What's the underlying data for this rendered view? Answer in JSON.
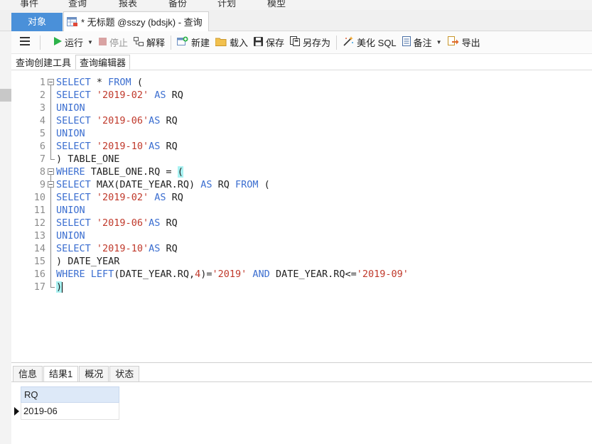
{
  "menu": {
    "items": [
      "事件",
      "查询",
      "报表",
      "备份",
      "计划",
      "模型"
    ]
  },
  "tabs": {
    "objects": "对象",
    "query": "* 无标题 @sszy (bdsjk) - 查询"
  },
  "toolbar": {
    "run": "运行",
    "stop": "停止",
    "explain": "解释",
    "new": "新建",
    "load": "载入",
    "save": "保存",
    "save_as": "另存为",
    "beautify": "美化 SQL",
    "notes": "备注",
    "export": "导出"
  },
  "subtabs": {
    "builder": "查询创建工具",
    "editor": "查询编辑器"
  },
  "editor": {
    "lines": [
      {
        "n": "1",
        "fold": "start",
        "tokens": [
          {
            "t": "kw",
            "v": "SELECT"
          },
          {
            "t": "pl",
            "v": " * "
          },
          {
            "t": "kw",
            "v": "FROM"
          },
          {
            "t": "pl",
            "v": " ("
          }
        ]
      },
      {
        "n": "2",
        "fold": "mid",
        "tokens": [
          {
            "t": "kw",
            "v": "SELECT"
          },
          {
            "t": "pl",
            "v": " "
          },
          {
            "t": "str",
            "v": "'2019-02'"
          },
          {
            "t": "pl",
            "v": " "
          },
          {
            "t": "kw",
            "v": "AS"
          },
          {
            "t": "pl",
            "v": " RQ"
          }
        ]
      },
      {
        "n": "3",
        "fold": "mid",
        "tokens": [
          {
            "t": "kw",
            "v": "UNION"
          }
        ]
      },
      {
        "n": "4",
        "fold": "mid",
        "tokens": [
          {
            "t": "kw",
            "v": "SELECT"
          },
          {
            "t": "pl",
            "v": " "
          },
          {
            "t": "str",
            "v": "'2019-06'"
          },
          {
            "t": "kw",
            "v": "AS"
          },
          {
            "t": "pl",
            "v": " RQ"
          }
        ]
      },
      {
        "n": "5",
        "fold": "mid",
        "tokens": [
          {
            "t": "kw",
            "v": "UNION"
          }
        ]
      },
      {
        "n": "6",
        "fold": "mid",
        "tokens": [
          {
            "t": "kw",
            "v": "SELECT"
          },
          {
            "t": "pl",
            "v": " "
          },
          {
            "t": "str",
            "v": "'2019-10'"
          },
          {
            "t": "kw",
            "v": "AS"
          },
          {
            "t": "pl",
            "v": " RQ"
          }
        ]
      },
      {
        "n": "7",
        "fold": "end",
        "tokens": [
          {
            "t": "pl",
            "v": ") TABLE_ONE"
          }
        ]
      },
      {
        "n": "8",
        "fold": "start",
        "tokens": [
          {
            "t": "kw",
            "v": "WHERE"
          },
          {
            "t": "pl",
            "v": " TABLE_ONE.RQ = "
          },
          {
            "t": "brm",
            "v": "("
          }
        ]
      },
      {
        "n": "9",
        "fold": "start2",
        "tokens": [
          {
            "t": "kw",
            "v": "SELECT"
          },
          {
            "t": "pl",
            "v": " MAX(DATE_YEAR.RQ) "
          },
          {
            "t": "kw",
            "v": "AS"
          },
          {
            "t": "pl",
            "v": " RQ "
          },
          {
            "t": "kw",
            "v": "FROM"
          },
          {
            "t": "pl",
            "v": " ("
          }
        ]
      },
      {
        "n": "10",
        "fold": "mid",
        "tokens": [
          {
            "t": "kw",
            "v": "SELECT"
          },
          {
            "t": "pl",
            "v": " "
          },
          {
            "t": "str",
            "v": "'2019-02'"
          },
          {
            "t": "pl",
            "v": " "
          },
          {
            "t": "kw",
            "v": "AS"
          },
          {
            "t": "pl",
            "v": " RQ"
          }
        ]
      },
      {
        "n": "11",
        "fold": "mid",
        "tokens": [
          {
            "t": "kw",
            "v": "UNION"
          }
        ]
      },
      {
        "n": "12",
        "fold": "mid",
        "tokens": [
          {
            "t": "kw",
            "v": "SELECT"
          },
          {
            "t": "pl",
            "v": " "
          },
          {
            "t": "str",
            "v": "'2019-06'"
          },
          {
            "t": "kw",
            "v": "AS"
          },
          {
            "t": "pl",
            "v": " RQ"
          }
        ]
      },
      {
        "n": "13",
        "fold": "mid",
        "tokens": [
          {
            "t": "kw",
            "v": "UNION"
          }
        ]
      },
      {
        "n": "14",
        "fold": "mid",
        "tokens": [
          {
            "t": "kw",
            "v": "SELECT"
          },
          {
            "t": "pl",
            "v": " "
          },
          {
            "t": "str",
            "v": "'2019-10'"
          },
          {
            "t": "kw",
            "v": "AS"
          },
          {
            "t": "pl",
            "v": " RQ"
          }
        ]
      },
      {
        "n": "15",
        "fold": "mid",
        "tokens": [
          {
            "t": "pl",
            "v": ") DATE_YEAR"
          }
        ]
      },
      {
        "n": "16",
        "fold": "mid",
        "tokens": [
          {
            "t": "kw",
            "v": "WHERE"
          },
          {
            "t": "pl",
            "v": " "
          },
          {
            "t": "kw",
            "v": "LEFT"
          },
          {
            "t": "pl",
            "v": "(DATE_YEAR.RQ,"
          },
          {
            "t": "str",
            "v": "4"
          },
          {
            "t": "pl",
            "v": ")="
          },
          {
            "t": "str",
            "v": "'2019'"
          },
          {
            "t": "pl",
            "v": " "
          },
          {
            "t": "kw",
            "v": "AND"
          },
          {
            "t": "pl",
            "v": " DATE_YEAR.RQ<="
          },
          {
            "t": "str",
            "v": "'2019-09'"
          }
        ]
      },
      {
        "n": "17",
        "fold": "end",
        "tokens": [
          {
            "t": "brm",
            "v": ")"
          },
          {
            "t": "cursor",
            "v": ""
          }
        ]
      }
    ]
  },
  "result": {
    "tabs": [
      "信息",
      "结果1",
      "概况",
      "状态"
    ],
    "active_tab": "结果1",
    "columns": [
      "RQ"
    ],
    "rows": [
      [
        "2019-06"
      ]
    ]
  },
  "colors": {
    "accent": "#4a90d9",
    "keyword": "#3b6ed0",
    "string": "#c0392b",
    "bracket_match": "#a9f2f2",
    "grid_header": "#dde9f8"
  }
}
